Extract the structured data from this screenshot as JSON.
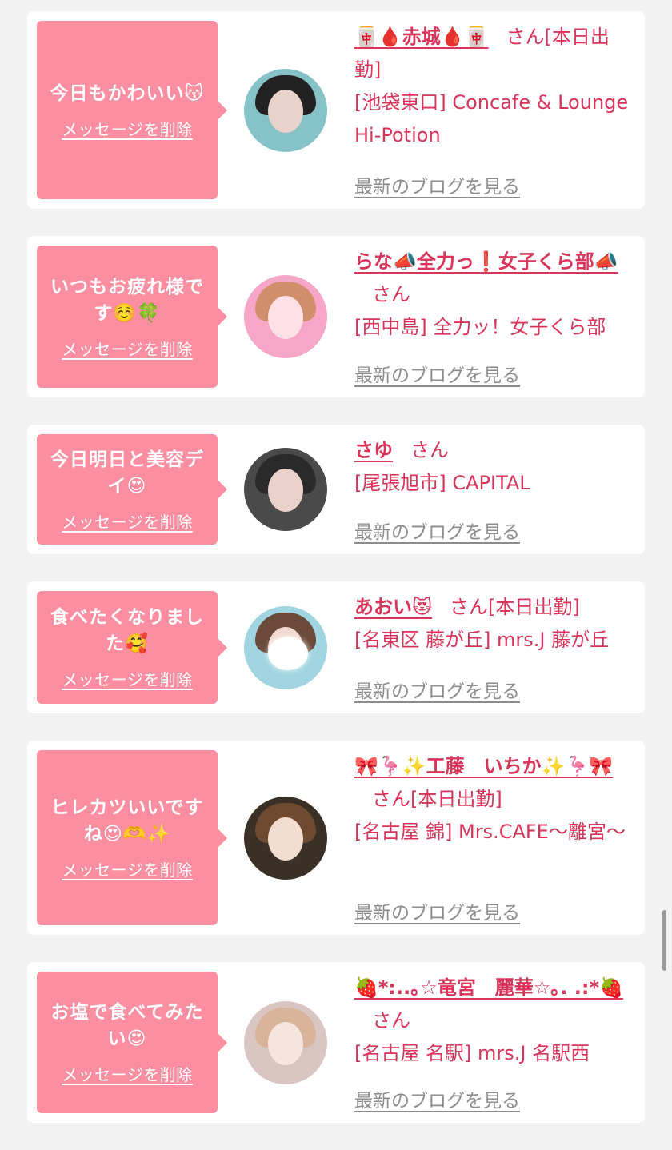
{
  "delete_label": "メッセージを削除",
  "blog_label": "最新のブログを見る",
  "san_label": "さん",
  "cards": [
    {
      "message": "今日もかわいい😽",
      "name": "🀄🩸赤城🩸🀄",
      "status": "[本日出勤]",
      "shop": "[池袋東口] Concafe & Lounge Hi-Potion",
      "avatar_colors": [
        "#86c3c9",
        "#e9d2c9",
        "#222222"
      ]
    },
    {
      "message": "いつもお疲れ様です☺️🍀",
      "name": "らな📣全力っ❗️女子くら部📣",
      "status": "",
      "shop": "[西中島] 全力ッ！女子くら部",
      "avatar_colors": [
        "#f6a7c8",
        "#ffe0e6",
        "#d08e6a"
      ]
    },
    {
      "message": "今日明日と美容デイ😍",
      "name": "さゆ",
      "status": "",
      "shop": "[尾張旭市] CAPITAL",
      "avatar_colors": [
        "#4a4a4a",
        "#e9d0c8",
        "#2a2a2a"
      ]
    },
    {
      "message": "食べたくなりました🥰",
      "name": "あおい😻",
      "status": "[本日出勤]",
      "shop": "[名東区 藤が丘] mrs.J 藤が丘",
      "avatar_colors": [
        "#9fd4e0",
        "#f1d8d0",
        "#6b4a3a"
      ]
    },
    {
      "message": "ヒレカツいいですね😍🫶✨",
      "name": "🎀🦩✨工藤　いちか✨🦩🎀",
      "status": "[本日出勤]",
      "shop": "[名古屋 錦] Mrs.CAFE〜離宮〜",
      "avatar_colors": [
        "#3a3026",
        "#f3dcd0",
        "#6e4a30"
      ]
    },
    {
      "message": "お塩で食べてみたい😍",
      "name": "🍓*:..｡☆竜宮　麗華☆｡. .:*🍓",
      "status": "",
      "shop": "[名古屋 名駅] mrs.J 名駅西",
      "avatar_colors": [
        "#d9c6c2",
        "#f6e4df",
        "#d8b49a"
      ]
    }
  ]
}
